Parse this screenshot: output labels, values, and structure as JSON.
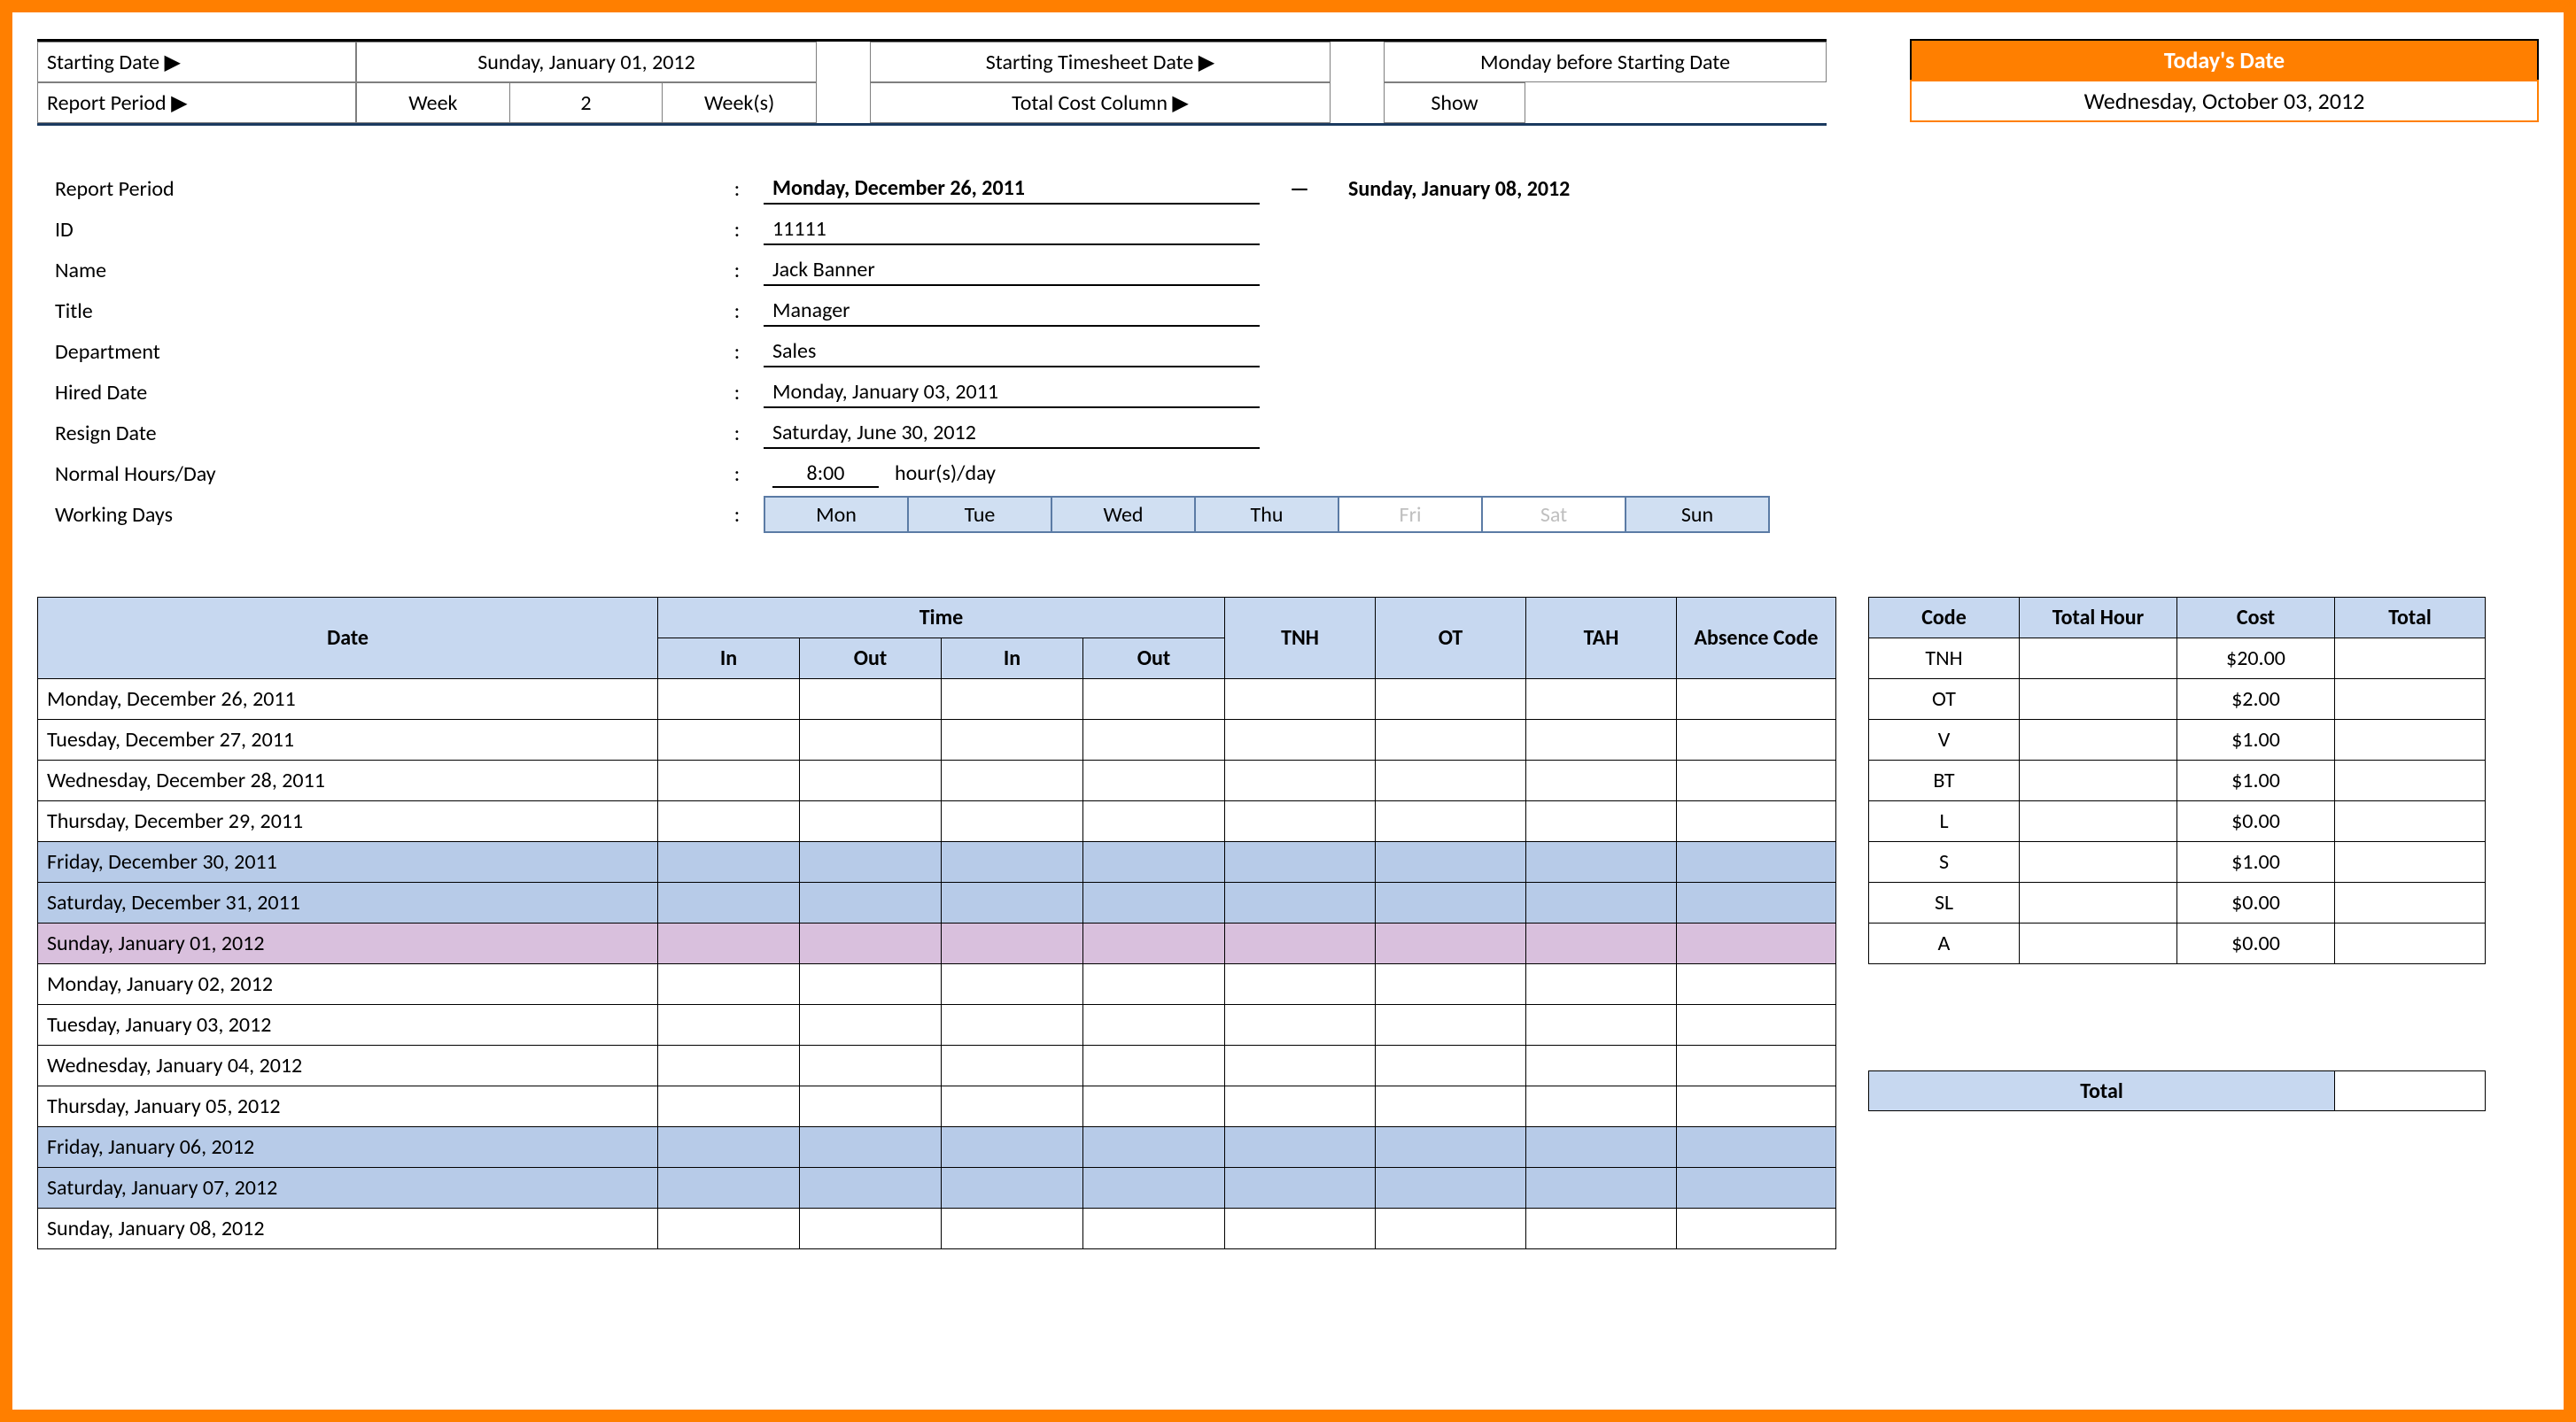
{
  "config": {
    "starting_date_label": "Starting Date ▶",
    "starting_date_value": "Sunday, January 01, 2012",
    "starting_ts_label": "Starting Timesheet Date ▶",
    "starting_ts_value": "Monday before Starting Date",
    "report_period_label": "Report Period ▶",
    "rp_week_label": "Week",
    "rp_week_num": "2",
    "rp_week_unit": "Week(s)",
    "total_cost_label": "Total Cost Column ▶",
    "total_cost_value": "Show"
  },
  "today": {
    "header": "Today's Date",
    "value": "Wednesday, October 03, 2012"
  },
  "info": {
    "report_period_label": "Report Period",
    "report_period_start": "Monday, December 26, 2011",
    "report_period_dash": "—",
    "report_period_end": "Sunday, January 08, 2012",
    "id_label": "ID",
    "id_value": "11111",
    "name_label": "Name",
    "name_value": "Jack Banner",
    "title_label": "Title",
    "title_value": "Manager",
    "dept_label": "Department",
    "dept_value": "Sales",
    "hired_label": "Hired Date",
    "hired_value": "Monday, January 03, 2011",
    "resign_label": "Resign Date",
    "resign_value": "Saturday, June 30, 2012",
    "hours_label": "Normal Hours/Day",
    "hours_value": "8:00",
    "hours_unit": "hour(s)/day",
    "days_label": "Working Days",
    "days": [
      "Mon",
      "Tue",
      "Wed",
      "Thu",
      "Fri",
      "Sat",
      "Sun"
    ]
  },
  "ts_headers": {
    "date": "Date",
    "time": "Time",
    "in": "In",
    "out": "Out",
    "tnh": "TNH",
    "ot": "OT",
    "tah": "TAH",
    "abs": "Absence Code"
  },
  "ts_rows": [
    {
      "date": "Monday, December 26, 2011",
      "cls": ""
    },
    {
      "date": "Tuesday, December 27, 2011",
      "cls": ""
    },
    {
      "date": "Wednesday, December 28, 2011",
      "cls": ""
    },
    {
      "date": "Thursday, December 29, 2011",
      "cls": ""
    },
    {
      "date": "Friday, December 30, 2011",
      "cls": "blue"
    },
    {
      "date": "Saturday, December 31, 2011",
      "cls": "blue"
    },
    {
      "date": "Sunday, January 01, 2012",
      "cls": "pink"
    },
    {
      "date": "Monday, January 02, 2012",
      "cls": ""
    },
    {
      "date": "Tuesday, January 03, 2012",
      "cls": ""
    },
    {
      "date": "Wednesday, January 04, 2012",
      "cls": ""
    },
    {
      "date": "Thursday, January 05, 2012",
      "cls": ""
    },
    {
      "date": "Friday, January 06, 2012",
      "cls": "blue"
    },
    {
      "date": "Saturday, January 07, 2012",
      "cls": "blue"
    },
    {
      "date": "Sunday, January 08, 2012",
      "cls": ""
    }
  ],
  "cost_headers": {
    "code": "Code",
    "totalhour": "Total Hour",
    "cost": "Cost",
    "total": "Total"
  },
  "cost_rows": [
    {
      "code": "TNH",
      "cost": "$20.00"
    },
    {
      "code": "OT",
      "cost": "$2.00"
    },
    {
      "code": "V",
      "cost": "$1.00"
    },
    {
      "code": "BT",
      "cost": "$1.00"
    },
    {
      "code": "L",
      "cost": "$0.00"
    },
    {
      "code": "S",
      "cost": "$1.00"
    },
    {
      "code": "SL",
      "cost": "$0.00"
    },
    {
      "code": "A",
      "cost": "$0.00"
    }
  ],
  "grand_total_label": "Total"
}
